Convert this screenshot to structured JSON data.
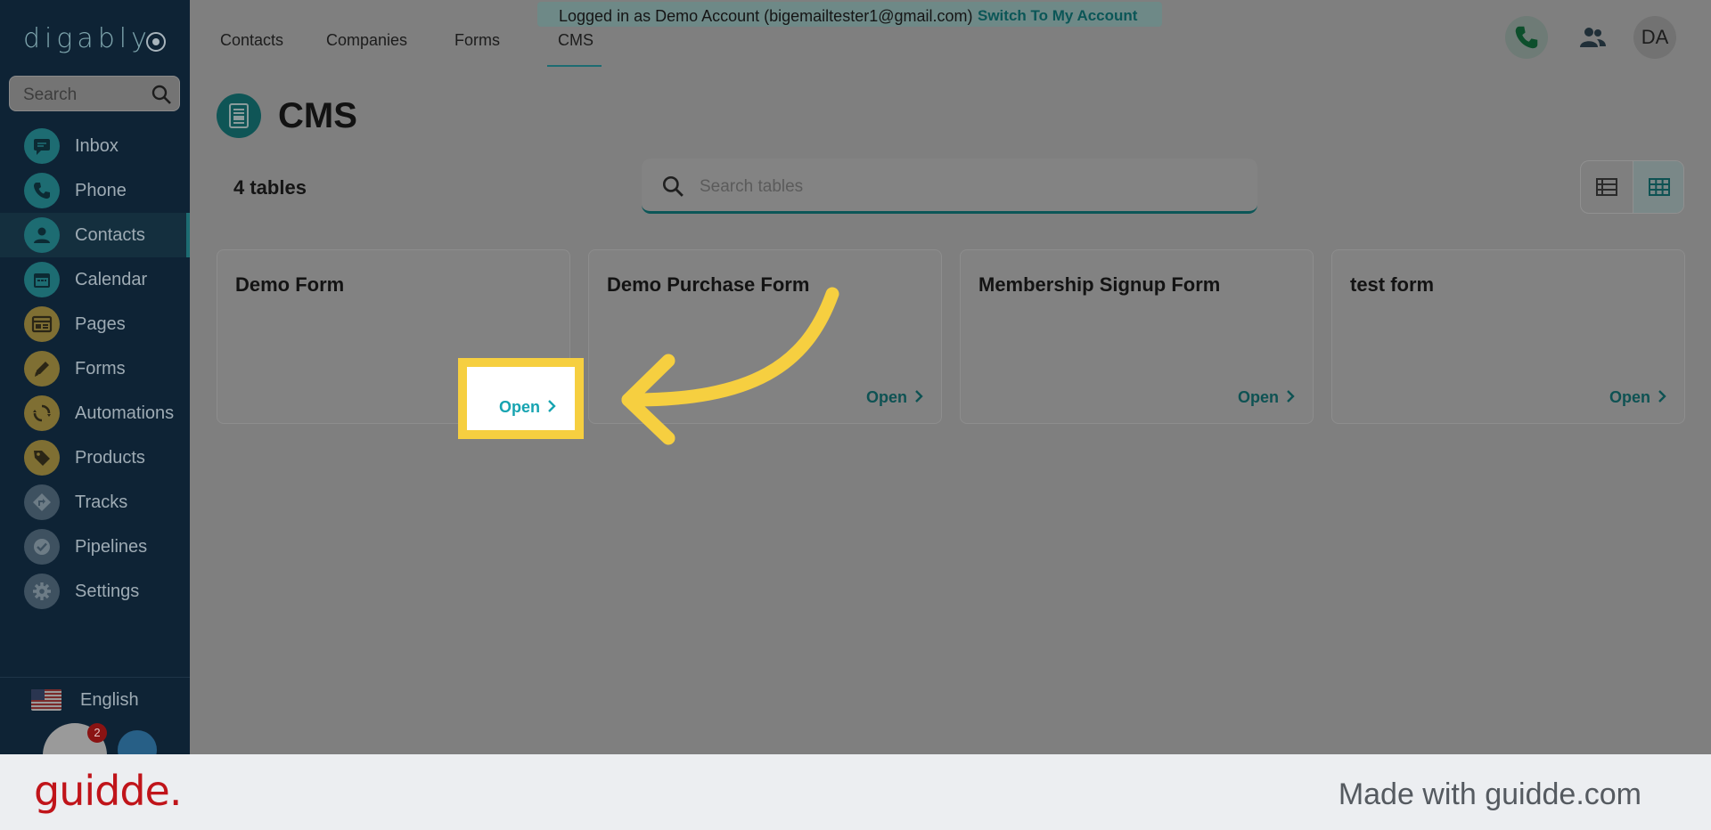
{
  "brand": {
    "logo_text": "digably"
  },
  "sidebar": {
    "search_placeholder": "Search",
    "items": [
      {
        "label": "Inbox",
        "icon": "chat-icon",
        "color": "#1d6c72"
      },
      {
        "label": "Phone",
        "icon": "phone-icon",
        "color": "#1d6c72"
      },
      {
        "label": "Contacts",
        "icon": "person-icon",
        "color": "#1d6c72",
        "active": true
      },
      {
        "label": "Calendar",
        "icon": "calendar-icon",
        "color": "#1d6c72"
      },
      {
        "label": "Pages",
        "icon": "pages-icon",
        "color": "#7f6f33"
      },
      {
        "label": "Forms",
        "icon": "pencil-icon",
        "color": "#7f6f33"
      },
      {
        "label": "Automations",
        "icon": "refresh-icon",
        "color": "#7f6f33"
      },
      {
        "label": "Products",
        "icon": "tag-icon",
        "color": "#7f6f33"
      },
      {
        "label": "Tracks",
        "icon": "route-icon",
        "color": "#3e5160"
      },
      {
        "label": "Pipelines",
        "icon": "check-icon",
        "color": "#3e5160"
      },
      {
        "label": "Settings",
        "icon": "gear-icon",
        "color": "#3e5160"
      }
    ],
    "language": "English",
    "notification_count": "2"
  },
  "topbar": {
    "tabs": [
      "Contacts",
      "Companies",
      "Forms",
      "CMS"
    ],
    "active_tab": "CMS",
    "banner_text": "Logged in as Demo Account (bigemailtester1@gmail.com)",
    "banner_link": "Switch To My Account",
    "avatar_initials": "DA"
  },
  "page": {
    "title": "CMS",
    "count_text": "4 tables",
    "search_placeholder": "Search tables"
  },
  "cards": [
    {
      "title": "Demo Form",
      "open_label": "Open"
    },
    {
      "title": "Demo Purchase Form",
      "open_label": "Open"
    },
    {
      "title": "Membership Signup Form",
      "open_label": "Open"
    },
    {
      "title": "test form",
      "open_label": "Open"
    }
  ],
  "highlight": {
    "open_label": "Open",
    "color": "#f6cf40"
  },
  "footer": {
    "logo": "guidde.",
    "made_with": "Made with guidde.com"
  }
}
